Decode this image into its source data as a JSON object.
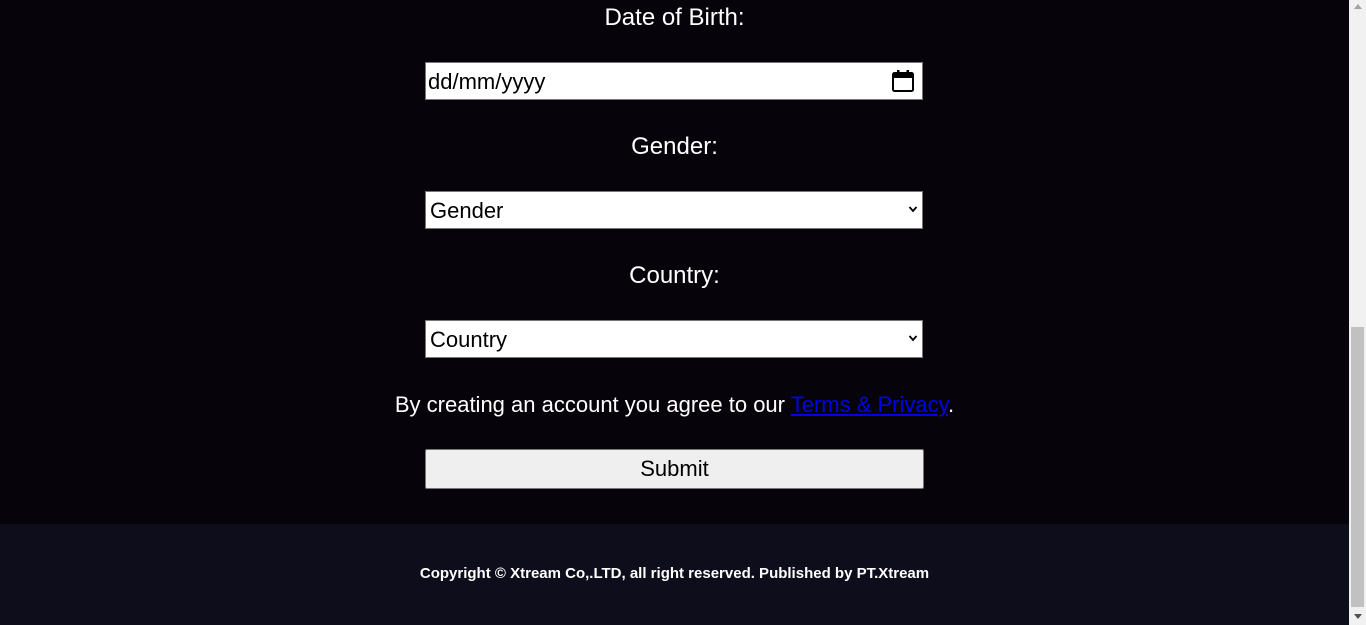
{
  "form": {
    "dob_label": "Date of Birth:",
    "dob_placeholder": "dd/mm/yyyy",
    "gender_label": "Gender:",
    "gender_selected": "Gender",
    "country_label": "Country:",
    "country_selected": "Country",
    "agree_prefix": "By creating an account you agree to our ",
    "agree_link": "Terms & Privacy",
    "agree_suffix": ".",
    "submit_label": "Submit"
  },
  "footer": {
    "copyright": "Copyright © Xtream Co,.LTD, all right reserved. Published by PT.Xtream"
  },
  "icons": {
    "calendar": "calendar-icon",
    "dropdown": "chevron-down-icon"
  },
  "colors": {
    "background": "#06040a",
    "footer_background": "#0e0d1c",
    "link": "#0000ee",
    "button": "#efefef"
  }
}
